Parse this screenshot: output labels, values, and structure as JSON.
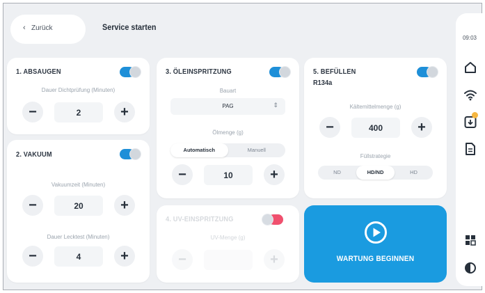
{
  "header": {
    "back_label": "Zurück",
    "back_icon": "chevron-left-icon",
    "title": "Service starten"
  },
  "sidebar": {
    "time": "09:03",
    "icons": [
      "home-icon",
      "wifi-icon",
      "download-icon",
      "document-icon",
      "grid-icon",
      "contrast-icon"
    ],
    "badge_color": "#f5b640"
  },
  "cards": {
    "absaugen": {
      "title": "1. ABSAUGEN",
      "toggle": "on",
      "field_label": "Dauer Dichtprüfung (Minuten)",
      "value": "2"
    },
    "vakuum": {
      "title": "2. VAKUUM",
      "toggle": "on",
      "field1_label": "Vakuumzeit (Minuten)",
      "value1": "20",
      "field2_label": "Dauer Lecktest (Minuten)",
      "value2": "4"
    },
    "oel": {
      "title": "3. ÖLEINSPRITZUNG",
      "toggle": "on",
      "type_label": "Bauart",
      "type_value": "PAG",
      "amount_label": "Ölmenge (g)",
      "modes": [
        "Automatisch",
        "Manuell"
      ],
      "selected_mode": "Automatisch",
      "value": "10"
    },
    "uv": {
      "title": "4. UV-EINSPRITZUNG",
      "toggle": "off",
      "field_label": "UV-Menge (g)",
      "value": ""
    },
    "befuellen": {
      "title": "5. BEFÜLLEN",
      "subtitle": "R134a",
      "toggle": "on",
      "field_label": "Kältemittelmenge (g)",
      "value": "400",
      "pressure_label": "Füllstrategie",
      "pressure_options": [
        "ND",
        "HD/ND",
        "HD"
      ],
      "selected_pressure": "HD/ND"
    }
  },
  "start_button": {
    "label": "WARTUNG BEGINNEN",
    "icon": "play-icon",
    "color": "#1a9be0"
  },
  "colors": {
    "accent": "#1e8fd8",
    "toggle_off": "#f0506e"
  }
}
